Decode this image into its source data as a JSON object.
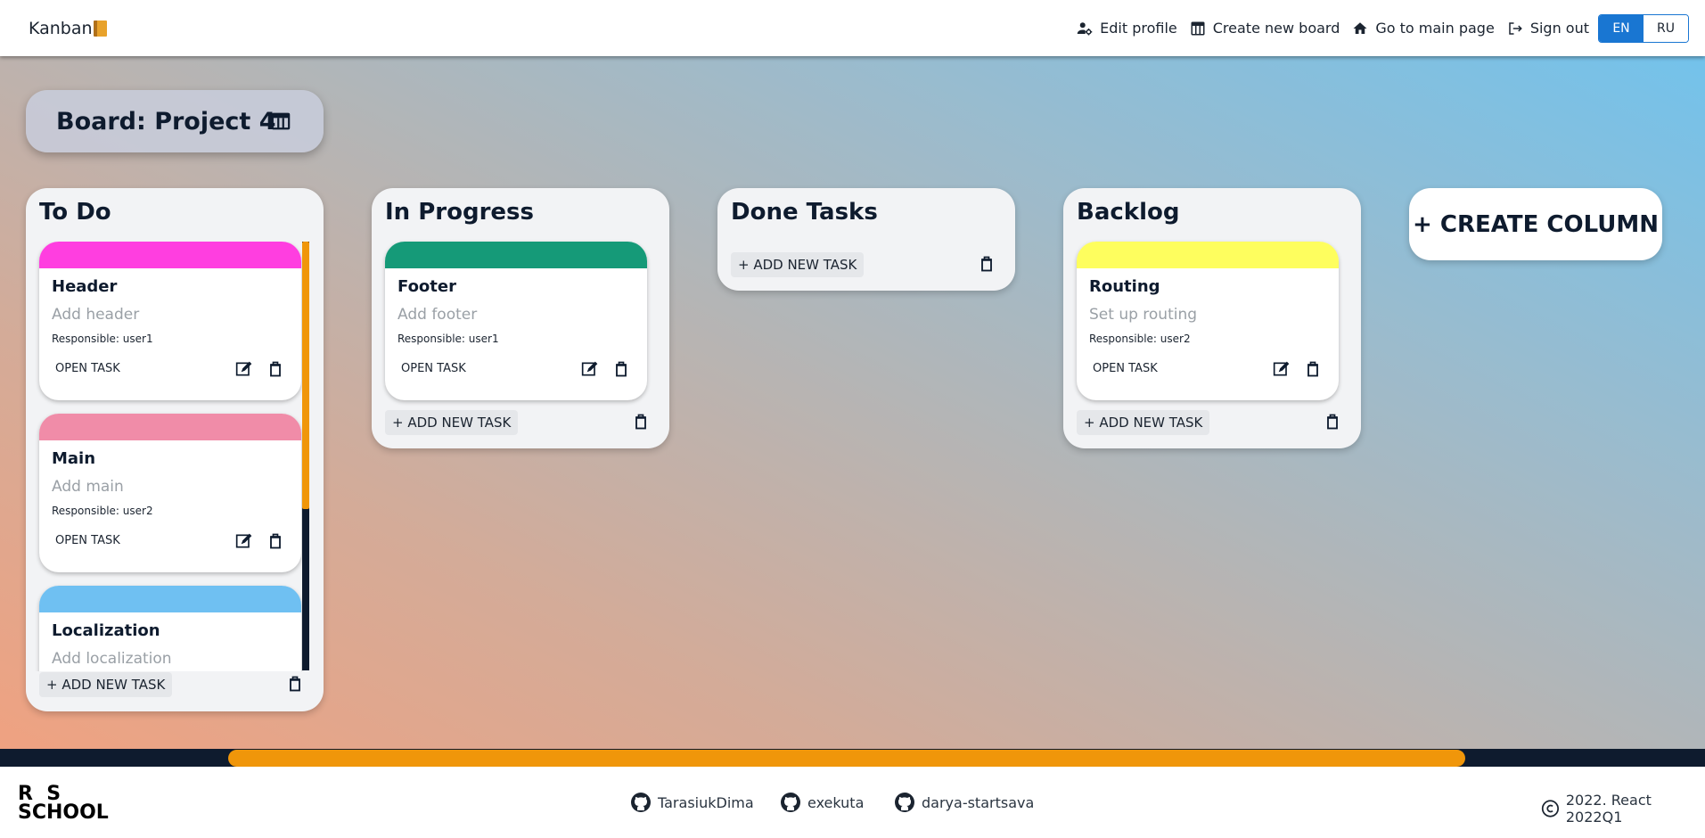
{
  "header": {
    "logo": "Kanban",
    "nav": {
      "edit_profile": "Edit profile",
      "create_board": "Create new board",
      "main_page": "Go to main page",
      "sign_out": "Sign out"
    },
    "lang": {
      "en": "EN",
      "ru": "RU",
      "active": "EN"
    }
  },
  "board": {
    "title": "Board: Project 4"
  },
  "columns": [
    {
      "title": "To Do",
      "add_task": "+ ADD NEW TASK",
      "tasks": [
        {
          "title": "Header",
          "description": "Add header",
          "responsible": "Responsible: user1",
          "open": "OPEN TASK",
          "color": "#ff3ee0"
        },
        {
          "title": "Main",
          "description": "Add main",
          "responsible": "Responsible: user2",
          "open": "OPEN TASK",
          "color": "#f08ca8"
        },
        {
          "title": "Localization",
          "description": "Add localization",
          "color": "#6fc0f2"
        }
      ]
    },
    {
      "title": "In Progress",
      "add_task": "+ ADD NEW TASK",
      "tasks": [
        {
          "title": "Footer",
          "description": "Add footer",
          "responsible": "Responsible: user1",
          "open": "OPEN TASK",
          "color": "#159a78"
        }
      ]
    },
    {
      "title": "Done Tasks",
      "add_task": "+ ADD NEW TASK",
      "tasks": []
    },
    {
      "title": "Backlog",
      "add_task": "+ ADD NEW TASK",
      "tasks": [
        {
          "title": "Routing",
          "description": "Set up routing",
          "responsible": "Responsible: user2",
          "open": "OPEN TASK",
          "color": "#fefe5e"
        }
      ]
    }
  ],
  "create_column": "+ CREATE COLUMN",
  "footer": {
    "logo_line1": "R  S",
    "logo_line2": "SCHOOL",
    "authors": [
      "TarasiukDima",
      "exekuta",
      "darya-startsava"
    ],
    "copyright": "2022. React 2022Q1"
  },
  "colors": {
    "accent": "#1976d2",
    "scrollbar": "#f0960a",
    "dark": "#0e1b2e"
  }
}
